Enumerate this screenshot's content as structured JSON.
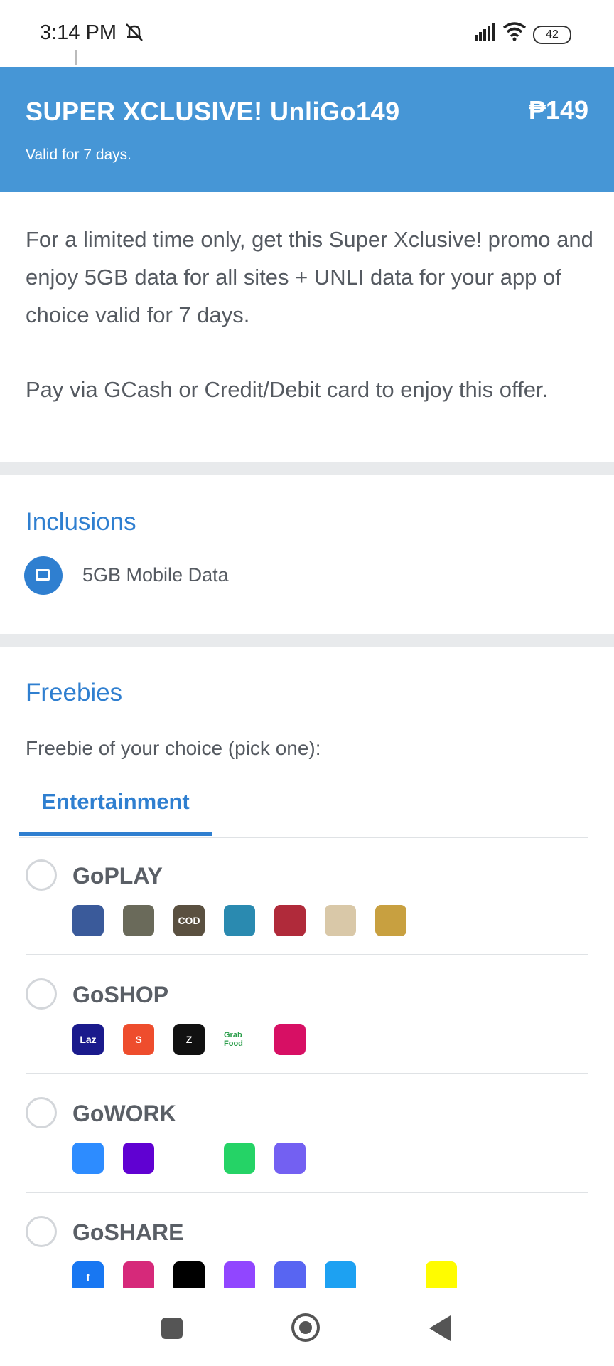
{
  "status_bar": {
    "time": "3:14 PM",
    "battery": "42"
  },
  "header": {
    "title": "SUPER XCLUSIVE! UnliGo149",
    "price": "₱149",
    "validity": "Valid for 7 days."
  },
  "description": {
    "paragraph1": "For a limited time only, get this Super Xclusive! promo and enjoy 5GB data for all sites + UNLI data for your app of choice valid for 7 days.",
    "paragraph2": "Pay via GCash or Credit/Debit card to enjoy this offer."
  },
  "inclusions": {
    "title": "Inclusions",
    "items": [
      {
        "label": "5GB Mobile Data",
        "icon": "mobile-data-icon"
      }
    ]
  },
  "freebies": {
    "title": "Freebies",
    "note": "Freebie of your choice (pick one):",
    "tabs": [
      {
        "label": "Entertainment",
        "active": true
      }
    ],
    "options": [
      {
        "label": "GoPLAY",
        "apps": [
          {
            "name": "mobile-legends-icon",
            "text": "",
            "color": "#3a5a9a"
          },
          {
            "name": "pubg-icon",
            "text": "",
            "color": "#6a6a5a"
          },
          {
            "name": "call-of-duty-icon",
            "text": "COD",
            "color": "#5a5040"
          },
          {
            "name": "league-wild-rift-icon",
            "text": "",
            "color": "#2a8ab0"
          },
          {
            "name": "arena-game-icon",
            "text": "",
            "color": "#b02a3a"
          },
          {
            "name": "anime-game-icon",
            "text": "",
            "color": "#d9c8a8"
          },
          {
            "name": "action-game-icon",
            "text": "",
            "color": "#c8a040"
          }
        ]
      },
      {
        "label": "GoSHOP",
        "apps": [
          {
            "name": "lazada-icon",
            "text": "Laz",
            "color": "#1a1a8c"
          },
          {
            "name": "shopee-icon",
            "text": "S",
            "color": "#ee4d2d"
          },
          {
            "name": "zalora-icon",
            "text": "Z",
            "color": "#111111"
          },
          {
            "name": "grabfood-icon",
            "text": "Grab Food",
            "color": "#ffffff"
          },
          {
            "name": "foodpanda-icon",
            "text": "",
            "color": "#d70f64"
          }
        ]
      },
      {
        "label": "GoWORK",
        "apps": [
          {
            "name": "zoom-icon",
            "text": "",
            "color": "#2d8cff"
          },
          {
            "name": "yahoo-mail-icon",
            "text": "",
            "color": "#6001d2"
          },
          {
            "name": "ms-teams-icon",
            "text": "",
            "color": "#ffffff"
          },
          {
            "name": "whatsapp-icon",
            "text": "",
            "color": "#25d366"
          },
          {
            "name": "viber-icon",
            "text": "",
            "color": "#7360f2"
          },
          {
            "name": "telegram-icon",
            "text": "",
            "color": "#ffffff"
          }
        ]
      },
      {
        "label": "GoSHARE",
        "apps": [
          {
            "name": "facebook-icon",
            "text": "f",
            "color": "#1877f2"
          },
          {
            "name": "instagram-icon",
            "text": "",
            "color": "#d6297a"
          },
          {
            "name": "tiktok-icon",
            "text": "",
            "color": "#000000"
          },
          {
            "name": "twitch-icon",
            "text": "",
            "color": "#9146ff"
          },
          {
            "name": "discord-icon",
            "text": "",
            "color": "#5865f2"
          },
          {
            "name": "twitter-icon",
            "text": "",
            "color": "#1da1f2"
          },
          {
            "name": "owl-app-icon",
            "text": "",
            "color": "#ffffff"
          },
          {
            "name": "snapchat-icon",
            "text": "",
            "color": "#fffc00"
          }
        ]
      }
    ]
  },
  "colors": {
    "brand_blue": "#4696d6",
    "accent_blue": "#2f7fd0",
    "text_gray": "#555a61"
  }
}
